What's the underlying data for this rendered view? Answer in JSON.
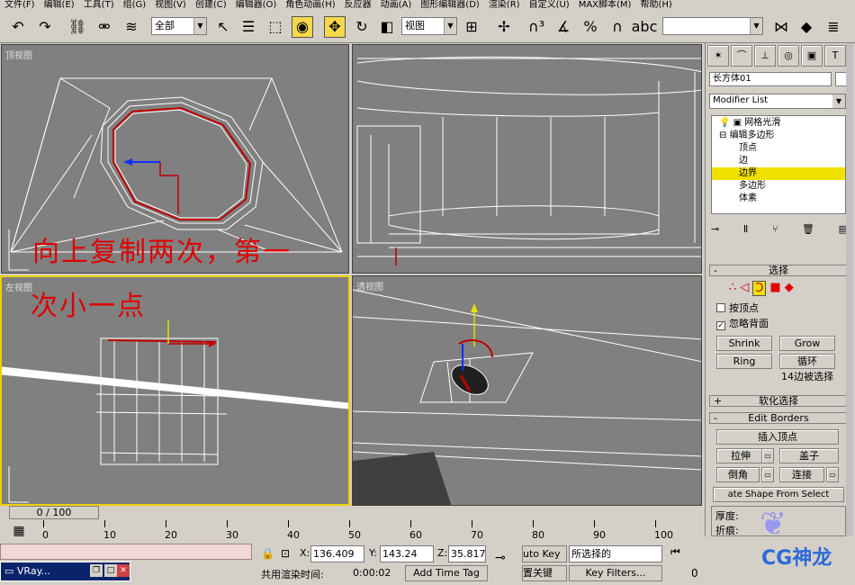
{
  "menu": [
    "文件(F)",
    "编辑(E)",
    "工具(T)",
    "组(G)",
    "视图(V)",
    "创建(C)",
    "编辑器(O)",
    "角色动画(H)",
    "反应器",
    "动画(A)",
    "图形编辑器(D)",
    "渲染(R)",
    "自定义(U)",
    "MAX脚本(M)",
    "帮助(H)"
  ],
  "toolbar": {
    "selection_filter": "全部",
    "ref_coord": "视图",
    "icons": [
      "undo-icon",
      "redo-icon",
      "link-icon",
      "unlink-icon",
      "bind-space-warp-icon",
      "select-arrow-icon",
      "select-by-name-icon",
      "rect-region-icon",
      "window-crossing-icon",
      "move-icon",
      "rotate-icon",
      "scale-icon",
      "mirror-icon",
      "align-icon",
      "render-icon"
    ]
  },
  "viewports": {
    "top": {
      "label": "顶视图"
    },
    "front": {
      "label": ""
    },
    "left": {
      "label": "左视图"
    },
    "persp": {
      "label": "透视图"
    }
  },
  "annotation": {
    "line1": "向上复制两次，第一",
    "line2": "次小一点"
  },
  "command_panel": {
    "object_name": "长方体01",
    "modifier_list": "Modifier List",
    "stack": [
      {
        "label": "网格光滑",
        "level": 0,
        "selected": false
      },
      {
        "label": "编辑多边形",
        "level": 0,
        "selected": false
      },
      {
        "label": "顶点",
        "level": 1,
        "selected": false
      },
      {
        "label": "边",
        "level": 1,
        "selected": false
      },
      {
        "label": "边界",
        "level": 1,
        "selected": true
      },
      {
        "label": "多边形",
        "level": 1,
        "selected": false
      },
      {
        "label": "体素",
        "level": 1,
        "selected": false
      }
    ],
    "selection": {
      "title": "选择",
      "by_vertex": "按顶点",
      "ignore_backfacing": "忽略背面",
      "ignore_backfacing_checked": true,
      "shrink": "Shrink",
      "grow": "Grow",
      "ring": "Ring",
      "loop": "循环",
      "selected_count": "14边被选择"
    },
    "soft_selection": {
      "title": "软化选择"
    },
    "edit_borders": {
      "title": "Edit Borders",
      "insert_vertex": "插入顶点",
      "extrude": "拉伸",
      "cap": "盖子",
      "chamfer": "倒角",
      "connect": "连接",
      "create_shape": "ate Shape From Select",
      "thickness_label": "厚度:",
      "fold_label": "折痕:"
    }
  },
  "timeline": {
    "frame": "0 / 100",
    "ticks": [
      "0",
      "10",
      "20",
      "30",
      "40",
      "50",
      "60",
      "70",
      "80",
      "90",
      "100"
    ],
    "ticks_offset": [
      "5",
      "15",
      "25",
      "35",
      "45",
      "55",
      "65",
      "75",
      "85",
      "95"
    ]
  },
  "status": {
    "x_label": "X:",
    "x": "136.409",
    "y_label": "Y:",
    "y": "143.24",
    "z_label": "Z:",
    "z": "35.817",
    "render_time_label": "共用渲染时间:",
    "render_time": "0:00:02",
    "add_time_tag": "Add Time Tag",
    "auto_key": "uto Key",
    "selected": "所选择的",
    "set_key": "置关键",
    "key_filters": "Key Filters...",
    "taskbar_item": "VRay..."
  },
  "watermark": {
    "text": "CG神龙"
  }
}
